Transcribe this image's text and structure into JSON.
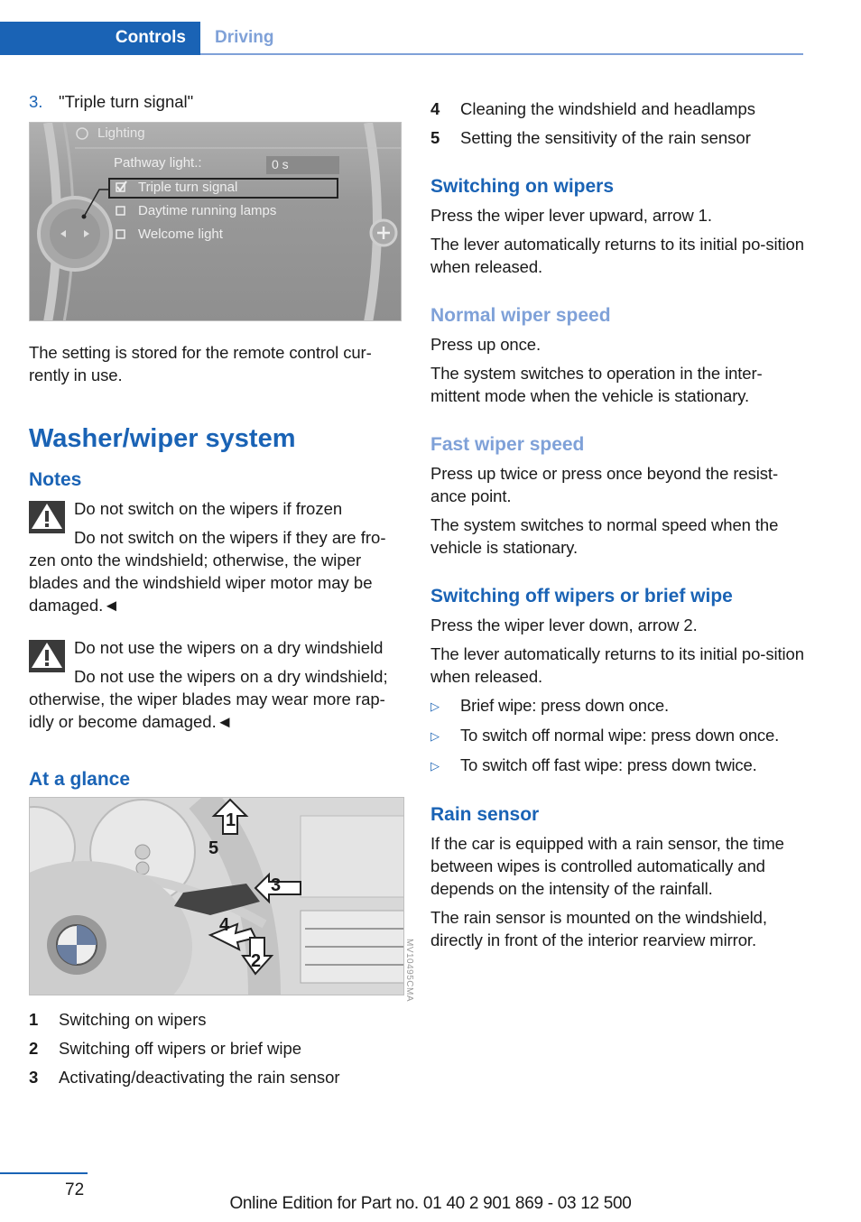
{
  "header": {
    "active_tab": "Controls",
    "inactive_tab": "Driving"
  },
  "left": {
    "step": {
      "number": "3.",
      "text": "\"Triple turn signal\""
    },
    "figure1": {
      "menu_title": "Lighting",
      "pathway_label": "Pathway light.:",
      "pathway_value": "0 s",
      "options": [
        {
          "label": "Triple turn signal",
          "checked": true,
          "selected": true
        },
        {
          "label": "Daytime running lamps",
          "checked": false,
          "selected": false
        },
        {
          "label": "Welcome light",
          "checked": false,
          "selected": false
        }
      ]
    },
    "stored_text": "The setting is stored for the remote control cur-rently in use.",
    "section_title": "Washer/wiper system",
    "notes_heading": "Notes",
    "warnings": [
      {
        "title": "Do not switch on the wipers if frozen",
        "body": "Do not switch on the wipers if they are fro-zen onto the windshield; otherwise, the wiper blades and the windshield wiper motor may be damaged.◄"
      },
      {
        "title": "Do not use the wipers on a dry windshield",
        "body": "Do not use the wipers on a dry windshield; otherwise, the wiper blades may wear more rap-idly or become damaged.◄"
      }
    ],
    "glance_heading": "At a glance",
    "figure2_code": "MV10495CMA",
    "figure2_labels": [
      "1",
      "2",
      "3",
      "4",
      "5"
    ],
    "legend": [
      {
        "num": "1",
        "text": "Switching on wipers"
      },
      {
        "num": "2",
        "text": "Switching off wipers or brief wipe"
      },
      {
        "num": "3",
        "text": "Activating/deactivating the rain sensor"
      }
    ]
  },
  "right": {
    "legend": [
      {
        "num": "4",
        "text": "Cleaning the windshield and headlamps"
      },
      {
        "num": "5",
        "text": "Setting the sensitivity of the rain sensor"
      }
    ],
    "switching_on": {
      "heading": "Switching on wipers",
      "p1": "Press the wiper lever upward, arrow 1.",
      "p2": "The lever automatically returns to its initial po-sition when released."
    },
    "normal_speed": {
      "heading": "Normal wiper speed",
      "p1": "Press up once.",
      "p2": "The system switches to operation in the inter-mittent mode when the vehicle is stationary."
    },
    "fast_speed": {
      "heading": "Fast wiper speed",
      "p1": "Press up twice or press once beyond the resist-ance point.",
      "p2": "The system switches to normal speed when the vehicle is stationary."
    },
    "switching_off": {
      "heading": "Switching off wipers or brief wipe",
      "p1": "Press the wiper lever down, arrow 2.",
      "p2": "The lever automatically returns to its initial po-sition when released.",
      "bullets": [
        "Brief wipe: press down once.",
        "To switch off normal wipe: press down once.",
        "To switch off fast wipe: press down twice."
      ]
    },
    "rain_sensor": {
      "heading": "Rain sensor",
      "p1": "If the car is equipped with a rain sensor, the time between wipes is controlled automatically and depends on the intensity of the rainfall.",
      "p2": "The rain sensor is mounted on the windshield, directly in front of the interior rearview mirror."
    }
  },
  "footer": {
    "page_number": "72",
    "edition_text": "Online Edition for Part no. 01 40 2 901 869 - 03 12 500"
  },
  "colors": {
    "accent": "#1a63b5",
    "accent_light": "#7fa1d8",
    "text": "#1a1a1a"
  }
}
